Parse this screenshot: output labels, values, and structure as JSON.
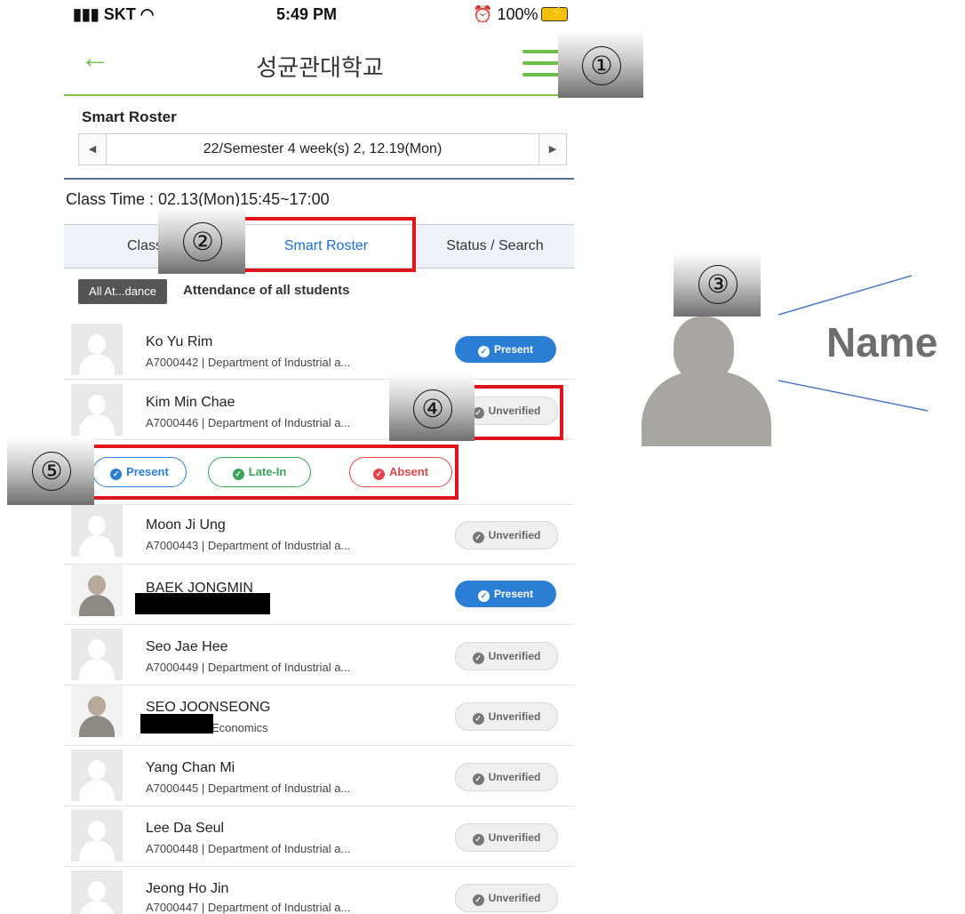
{
  "status_bar": {
    "carrier": "SKT",
    "time": "5:49 PM",
    "battery": "100%"
  },
  "header": {
    "title": "성균관대학교"
  },
  "roster": {
    "title": "Smart Roster",
    "semester": "22/Semester 4 week(s) 2, 12.19(Mon)",
    "class_time": "Class Time : 02.13(Mon)15:45~17:00"
  },
  "tabs": [
    {
      "label": "Class"
    },
    {
      "label": "Smart Roster"
    },
    {
      "label": "Status / Search"
    }
  ],
  "filter": {
    "badge": "All At...dance",
    "label": "Attendance of all students"
  },
  "students": [
    {
      "name": "Ko Yu Rim",
      "desc": "A7000442 | Department of Industrial a...",
      "status": "Present"
    },
    {
      "name": "Kim Min Chae",
      "desc": "A7000446 | Department of Industrial a...",
      "status": "Unverified"
    },
    {
      "name": "Moon Ji Ung",
      "desc": "A7000443 | Department of Industrial a...",
      "status": "Unverified"
    },
    {
      "name": "BAEK JONGMIN",
      "desc": "",
      "status": "Present"
    },
    {
      "name": "Seo Jae Hee",
      "desc": "A7000449 | Department of Industrial a...",
      "status": "Unverified"
    },
    {
      "name": "SEO JOONSEONG",
      "desc": "Economics",
      "status": "Unverified"
    },
    {
      "name": "Yang Chan Mi",
      "desc": "A7000445 | Department of Industrial a...",
      "status": "Unverified"
    },
    {
      "name": "Lee Da Seul",
      "desc": "A7000448 | Department of Industrial a...",
      "status": "Unverified"
    },
    {
      "name": "Jeong Ho Jin",
      "desc": "A7000447 | Department of Industrial a...",
      "status": "Unverified"
    }
  ],
  "choices": {
    "present": "Present",
    "late": "Late-In",
    "absent": "Absent"
  },
  "annotations": {
    "n1": "①",
    "n2": "②",
    "n3": "③",
    "n4": "④",
    "n5": "⑤",
    "name_label": "Name"
  },
  "colors": {
    "accent_green": "#6cc04a",
    "present_blue": "#2a7fd4",
    "late_green": "#3aa55a",
    "absent_red": "#e0464a",
    "highlight_red": "#e0141b"
  }
}
